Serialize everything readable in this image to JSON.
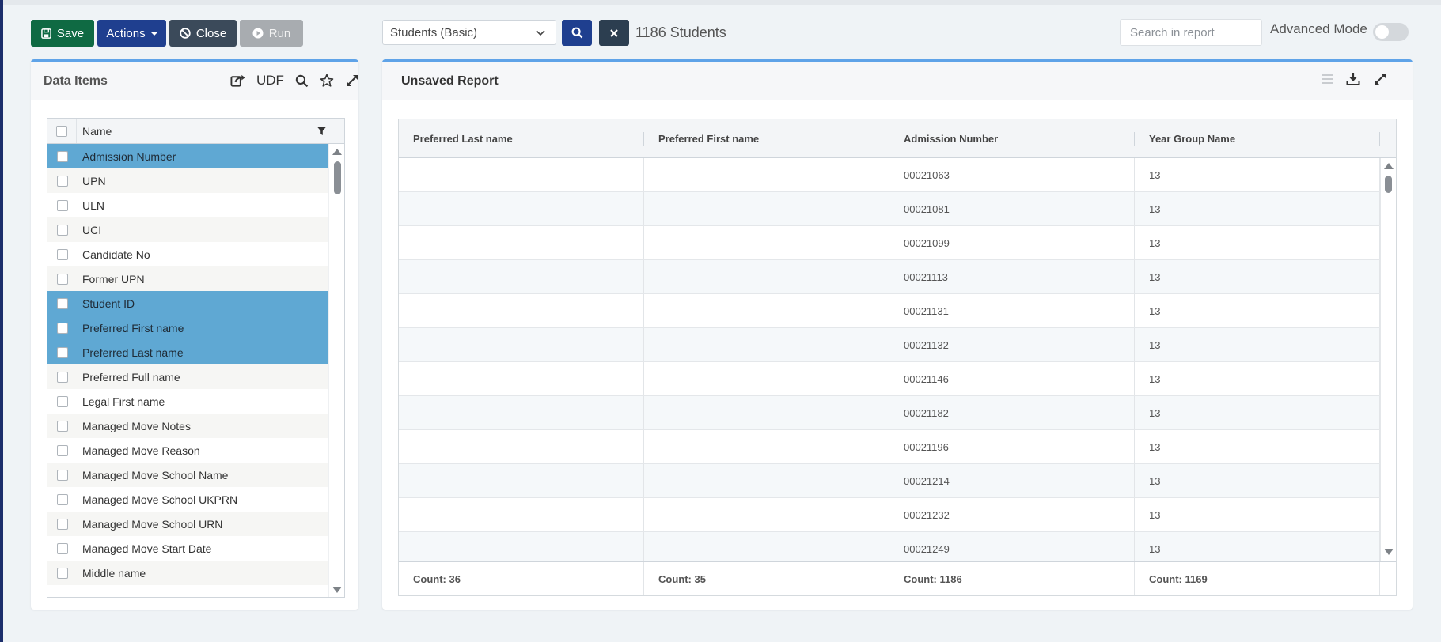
{
  "toolbar": {
    "save_label": "Save",
    "actions_label": "Actions",
    "close_label": "Close",
    "run_label": "Run",
    "report_type": "Students (Basic)",
    "student_count": "1186 Students",
    "search_placeholder": "Search in report",
    "advanced_mode_label": "Advanced Mode",
    "advanced_mode_on": false
  },
  "colors": {
    "save": "#0f6a43",
    "primary": "#1f3f8f",
    "close": "#3b4a5a",
    "run_disabled": "#a8acb0",
    "selected_row": "#5fa8d3",
    "panel_accent": "#5fa3e8"
  },
  "data_items": {
    "title": "Data Items",
    "udf_label": "UDF",
    "column_header": "Name",
    "items": [
      {
        "label": "Admission Number",
        "selected": true
      },
      {
        "label": "UPN",
        "selected": false
      },
      {
        "label": "ULN",
        "selected": false
      },
      {
        "label": "UCI",
        "selected": false
      },
      {
        "label": "Candidate No",
        "selected": false
      },
      {
        "label": "Former UPN",
        "selected": false
      },
      {
        "label": "Student ID",
        "selected": true
      },
      {
        "label": "Preferred First name",
        "selected": true
      },
      {
        "label": "Preferred Last name",
        "selected": true
      },
      {
        "label": "Preferred Full name",
        "selected": false
      },
      {
        "label": "Legal First name",
        "selected": false
      },
      {
        "label": "Managed Move Notes",
        "selected": false
      },
      {
        "label": "Managed Move Reason",
        "selected": false
      },
      {
        "label": "Managed Move School Name",
        "selected": false
      },
      {
        "label": "Managed Move School UKPRN",
        "selected": false
      },
      {
        "label": "Managed Move School URN",
        "selected": false
      },
      {
        "label": "Managed Move Start Date",
        "selected": false
      },
      {
        "label": "Middle name",
        "selected": false
      }
    ]
  },
  "report": {
    "title": "Unsaved Report",
    "columns": [
      "Preferred Last name",
      "Preferred First name",
      "Admission Number",
      "Year Group Name"
    ],
    "rows": [
      [
        "",
        "",
        "00021063",
        "13"
      ],
      [
        "",
        "",
        "00021081",
        "13"
      ],
      [
        "",
        "",
        "00021099",
        "13"
      ],
      [
        "",
        "",
        "00021113",
        "13"
      ],
      [
        "",
        "",
        "00021131",
        "13"
      ],
      [
        "",
        "",
        "00021132",
        "13"
      ],
      [
        "",
        "",
        "00021146",
        "13"
      ],
      [
        "",
        "",
        "00021182",
        "13"
      ],
      [
        "",
        "",
        "00021196",
        "13"
      ],
      [
        "",
        "",
        "00021214",
        "13"
      ],
      [
        "",
        "",
        "00021232",
        "13"
      ],
      [
        "",
        "",
        "00021249",
        "13"
      ]
    ],
    "footer": [
      "Count: 36",
      "Count: 35",
      "Count: 1186",
      "Count: 1169"
    ]
  }
}
